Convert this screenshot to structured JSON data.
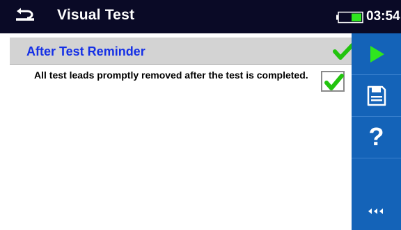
{
  "header": {
    "title": "Visual Test",
    "time": "03:54",
    "back_icon": "back-arrow-icon",
    "battery_icon": "battery-icon"
  },
  "section": {
    "title": "After Test Reminder",
    "status_icon": "check-icon"
  },
  "items": [
    {
      "text": "All test leads promptly removed after the test is completed.",
      "checked": true
    }
  ],
  "sidebar": {
    "buttons": [
      "start-icon",
      "save-icon",
      "help-icon",
      "more-options-icon"
    ],
    "help_glyph": "?"
  },
  "colors": {
    "titlebar": "#0a0a26",
    "section_title": "#1530e6",
    "sidebar": "#1463b8",
    "check": "#22c40e",
    "play": "#2fe61f"
  }
}
